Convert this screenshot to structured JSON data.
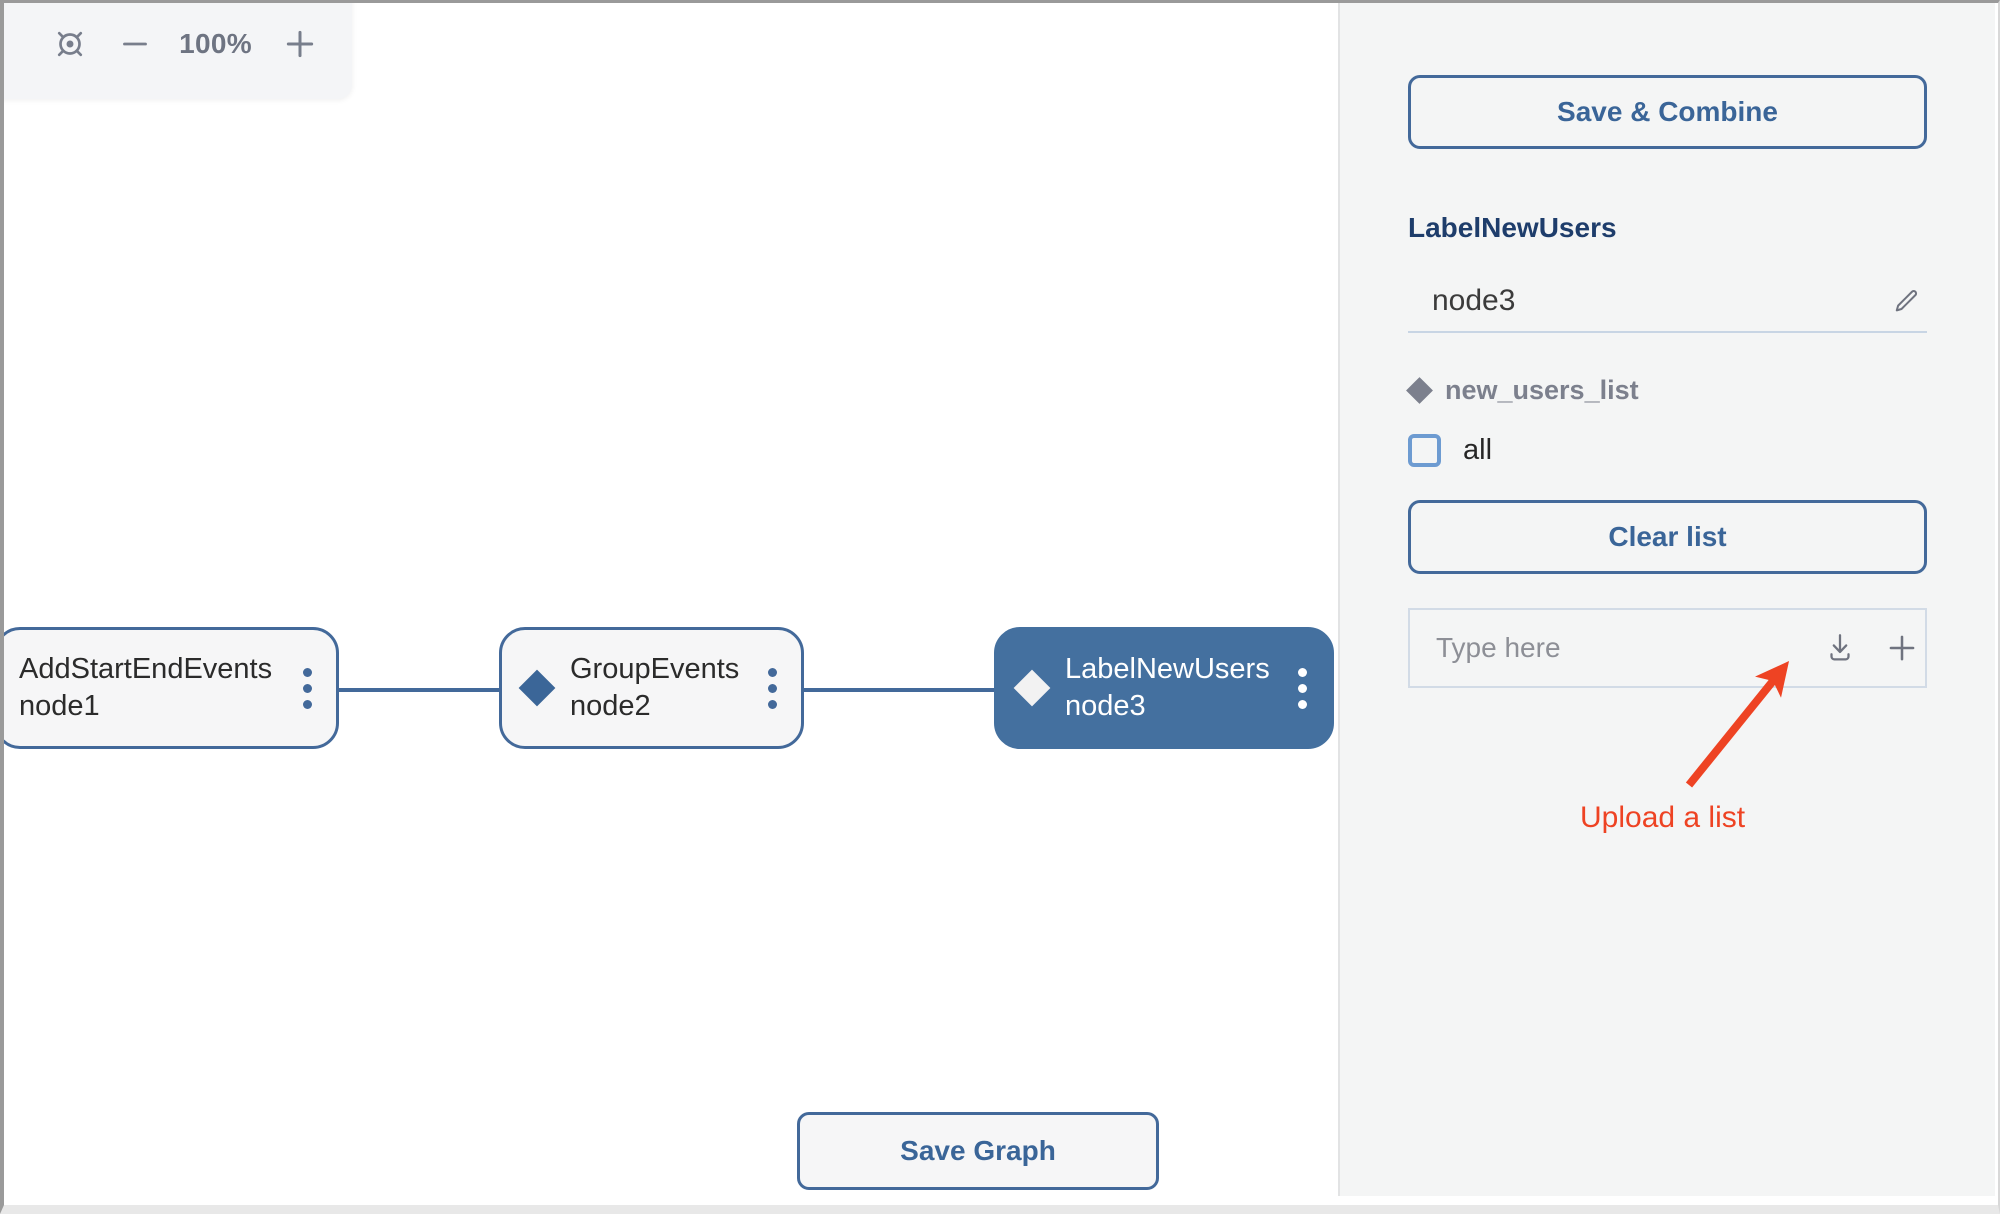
{
  "canvas": {
    "zoom_control": {
      "fit_icon": "fit-to-view-icon",
      "zoom_out_icon": "minus-icon",
      "zoom_level": "100%",
      "zoom_in_icon": "plus-icon"
    },
    "nodes": [
      {
        "id": "node1",
        "title": "AddStartEndEvents",
        "subtitle": "node1",
        "has_diamond": false,
        "selected": false,
        "menu_icon": "kebab-menu-icon"
      },
      {
        "id": "node2",
        "title": "GroupEvents",
        "subtitle": "node2",
        "has_diamond": true,
        "selected": false,
        "menu_icon": "kebab-menu-icon"
      },
      {
        "id": "node3",
        "title": "LabelNewUsers",
        "subtitle": "node3",
        "has_diamond": true,
        "selected": true,
        "menu_icon": "kebab-menu-icon"
      }
    ],
    "save_graph_label": "Save Graph"
  },
  "panel": {
    "save_combine_label": "Save & Combine",
    "node_title": "LabelNewUsers",
    "node_name_value": "node3",
    "node_name_edit_icon": "pencil-edit-icon",
    "param_diamond_icon": "diamond-icon",
    "param_label": "new_users_list",
    "all_checkbox_label": "all",
    "all_checkbox_checked": false,
    "clear_list_label": "Clear list",
    "list_input_value": "",
    "list_input_placeholder": "Type here",
    "upload_icon": "download-upload-icon",
    "add_icon": "plus-icon"
  },
  "annotation": {
    "text": "Upload a list",
    "color": "#ee4323"
  },
  "colors": {
    "accent_blue": "#43699a",
    "selected_node_blue": "#44709f",
    "panel_bg": "#f4f5f5",
    "title_blue": "#1e3d6b",
    "checkbox_blue": "#6d9bd1",
    "muted_grey": "#7c808d",
    "annotation_red": "#ee4323"
  }
}
